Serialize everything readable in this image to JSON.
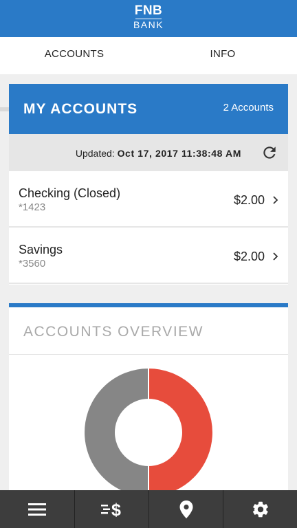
{
  "header": {
    "logo_main": "FNB",
    "logo_sub": "BANK"
  },
  "tabs": [
    {
      "label": "ACCOUNTS",
      "active": true
    },
    {
      "label": "INFO",
      "active": false
    }
  ],
  "accounts_card": {
    "title": "MY ACCOUNTS",
    "count_label": "2 Accounts",
    "updated_label": "Updated:",
    "updated_value": "Oct 17, 2017 11:38:48 AM",
    "refresh_icon": "refresh-icon",
    "accounts": [
      {
        "name": "Checking (Closed)",
        "number": "*1423",
        "balance": "$2.00"
      },
      {
        "name": "Savings",
        "number": "*3560",
        "balance": "$2.00"
      }
    ]
  },
  "overview": {
    "title": "ACCOUNTS OVERVIEW",
    "slices": [
      {
        "value": 2.0,
        "color": "#e74c3c"
      },
      {
        "value": 2.0,
        "color": "#868686"
      }
    ]
  },
  "bottom_nav": [
    {
      "icon": "menu-icon"
    },
    {
      "icon": "transfer-money-icon"
    },
    {
      "icon": "location-pin-icon"
    },
    {
      "icon": "gear-icon"
    }
  ],
  "colors": {
    "brand_blue": "#2a7ac7",
    "nav_dark": "#3d3d3d",
    "chart_red": "#e74c3c",
    "chart_gray": "#868686"
  }
}
